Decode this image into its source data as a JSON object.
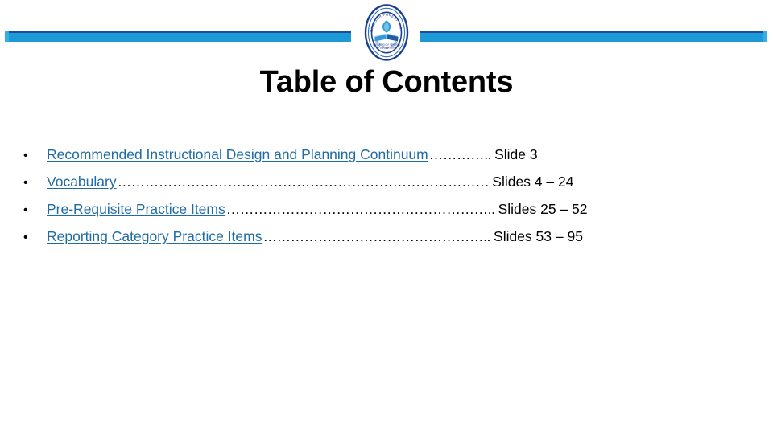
{
  "slide": {
    "title": "Table of Contents",
    "background_color": "#ffffff"
  },
  "header": {
    "rule_color": "#1C9AD6",
    "rule_top_color": "#1B4F9C",
    "rule_cap_color": "#37AEE2",
    "logo": {
      "name": "school-seal-logo",
      "ring_color": "#1B3F8F",
      "accent_color": "#2E9BD6",
      "outer_text": "WINDSOR FOREST HIGH SCHOOL",
      "inner_text_line1": "Preparing our students",
      "inner_text_line2": "for a better future"
    }
  },
  "contents": {
    "bullet_glyph": "•",
    "link_color": "#1F6BA5",
    "items": [
      {
        "label": "Recommended Instructional Design and Planning Continuum",
        "leader": "…………..",
        "pages": "Slide 3"
      },
      {
        "label": "Vocabulary",
        "leader": "………………………………………………………………………",
        "pages": "Slides 4 – 24"
      },
      {
        "label": "Pre-Requisite Practice Items",
        "leader": "…………………………………………………..",
        "pages": "Slides 25 – 52"
      },
      {
        "label": "Reporting Category Practice Items",
        "leader": "…………………………………………..",
        "pages": "Slides 53 – 95"
      }
    ]
  }
}
